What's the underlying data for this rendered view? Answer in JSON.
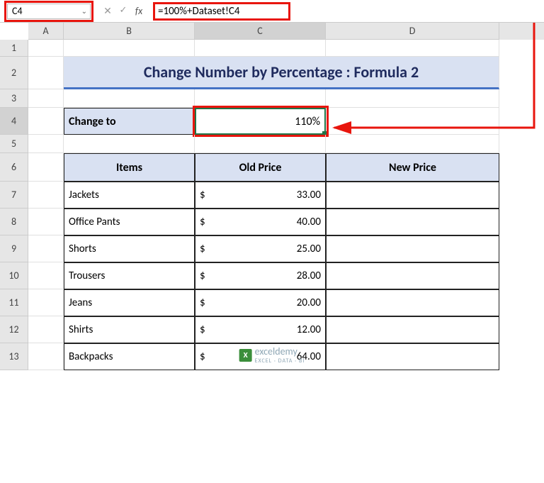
{
  "nameBox": "C4",
  "formula": "=100%+Dataset!C4",
  "columns": [
    "A",
    "B",
    "C",
    "D"
  ],
  "rowNums": [
    "1",
    "2",
    "3",
    "4",
    "5",
    "6",
    "7",
    "8",
    "9",
    "10",
    "11",
    "12",
    "13"
  ],
  "title": "Change Number by Percentage : Formula 2",
  "changeLabel": "Change to",
  "changeValue": "110%",
  "headers": {
    "items": "Items",
    "old": "Old Price",
    "new": "New Price"
  },
  "currency": "$",
  "items": [
    {
      "name": "Jackets",
      "price": "33.00"
    },
    {
      "name": "Office Pants",
      "price": "40.00"
    },
    {
      "name": "Shorts",
      "price": "25.00"
    },
    {
      "name": "Trousers",
      "price": "28.00"
    },
    {
      "name": "Jeans",
      "price": "20.00"
    },
    {
      "name": "Shirts",
      "price": "12.00"
    },
    {
      "name": "Backpacks",
      "price": "64.00"
    }
  ],
  "watermark": {
    "brand": "exceldemy",
    "sub": "EXCEL · DATA · BI"
  },
  "icons": {
    "cancel": "✕",
    "check": "✓",
    "fx": "fx",
    "chevron": "⌄"
  }
}
